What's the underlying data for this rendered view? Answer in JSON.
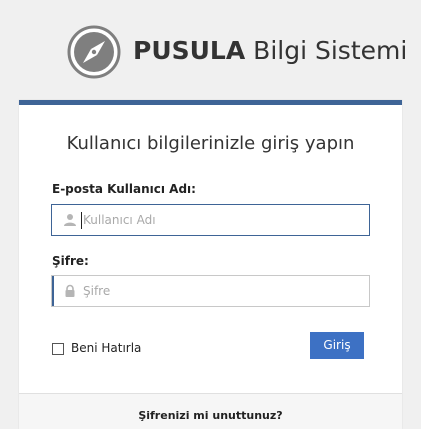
{
  "brand": {
    "name_bold": "PUSULA",
    "name_rest": "Bilgi Sistemi",
    "logo_icon": "compass-icon",
    "logo_color": "#7f7f7f"
  },
  "login": {
    "title": "Kullanıcı bilgilerinizle giriş yapın",
    "username_label": "E-posta Kullanıcı Adı:",
    "username_placeholder": "Kullanıcı Adı",
    "username_icon": "user-icon",
    "password_label": "Şifre:",
    "password_placeholder": "Şifre",
    "password_icon": "lock-icon",
    "remember_label": "Beni Hatırla",
    "remember_checked": false,
    "submit_label": "Giriş",
    "forgot_label": "Şifrenizi mi unuttunuz?"
  },
  "colors": {
    "accent": "#3e6496",
    "button": "#3d71c4",
    "background": "#f0f0f0"
  }
}
